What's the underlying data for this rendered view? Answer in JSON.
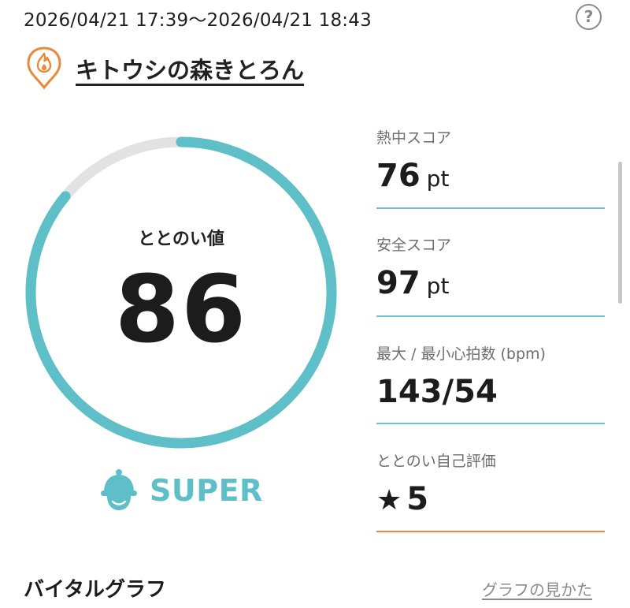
{
  "header": {
    "date_range": "2026/04/21 17:39〜2026/04/21 18:43",
    "help_label": "?"
  },
  "facility": {
    "name": "キトウシの森きとろん",
    "icon": "sauna-flame-pin-icon"
  },
  "gauge": {
    "label": "ととのい値",
    "value": "86",
    "fill_fraction": 0.86,
    "fill_color": "#5fbfc8",
    "track_color": "#e2e2e2"
  },
  "rank": {
    "label": "SUPER",
    "icon": "sauna-hat-face-icon",
    "color": "#5fbfc8"
  },
  "metrics": [
    {
      "label": "熱中スコア",
      "value": "76",
      "unit": "pt"
    },
    {
      "label": "安全スコア",
      "value": "97",
      "unit": "pt"
    },
    {
      "label": "最大 / 最小心拍数 (bpm)",
      "value": "143/54",
      "unit": ""
    },
    {
      "label": "ととのい自己評価",
      "value": "5",
      "unit": "",
      "icon": "star-icon"
    }
  ],
  "vital_section": {
    "title": "バイタルグラフ",
    "guide_link": "グラフの見かた"
  },
  "colors": {
    "accent_teal": "#5fbfc8",
    "accent_orange": "#e88a3a"
  }
}
